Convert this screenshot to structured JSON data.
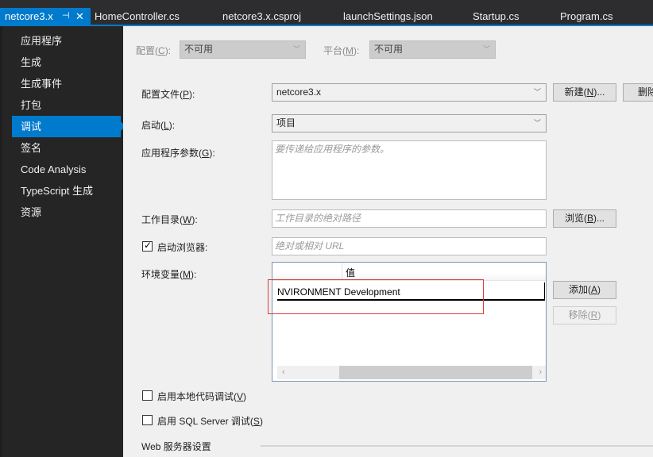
{
  "tabs": [
    {
      "label": "netcore3.x",
      "active": true,
      "pin_icon": "pin-icon",
      "close_icon": "close-icon"
    },
    {
      "label": "HomeController.cs"
    },
    {
      "label": "netcore3.x.csproj"
    },
    {
      "label": "launchSettings.json"
    },
    {
      "label": "Startup.cs"
    },
    {
      "label": "Program.cs"
    }
  ],
  "icons": {
    "pin": "⊣",
    "close": "✕",
    "chevron": "﹀",
    "check": "✓",
    "left": "‹",
    "right": "›"
  },
  "sidebar": {
    "items": [
      {
        "label": "应用程序"
      },
      {
        "label": "生成"
      },
      {
        "label": "生成事件"
      },
      {
        "label": "打包"
      },
      {
        "label": "调试",
        "active": true
      },
      {
        "label": "签名"
      },
      {
        "label": "Code Analysis"
      },
      {
        "label": "TypeScript 生成"
      },
      {
        "label": "资源"
      }
    ]
  },
  "config": {
    "label": "配置",
    "key": "C",
    "value": "不可用",
    "platform_label": "平台",
    "platform_key": "M",
    "platform_value": "不可用"
  },
  "profile": {
    "label": "配置文件",
    "key": "P",
    "value": "netcore3.x",
    "new_label": "新建",
    "new_key": "N",
    "new_suffix": "...",
    "delete_label": "删除"
  },
  "launch": {
    "label": "启动",
    "key": "L",
    "value": "项目"
  },
  "app_args": {
    "label": "应用程序参数",
    "key": "G",
    "placeholder": "要传递给应用程序的参数。"
  },
  "workdir": {
    "label": "工作目录",
    "key": "W",
    "placeholder": "工作目录的绝对路径",
    "browse_label": "浏览",
    "browse_key": "B",
    "browse_suffix": "..."
  },
  "browser": {
    "label": "启动浏览器:",
    "checked": true,
    "placeholder": "绝对或相对 URL"
  },
  "env": {
    "label": "环境变量",
    "key": "M",
    "columns": [
      "",
      "值"
    ],
    "rows": [
      {
        "name": "NVIRONMENT",
        "value": "Development"
      }
    ],
    "add_label": "添加",
    "add_key": "A",
    "remove_label": "移除",
    "remove_key": "R"
  },
  "native_debug": {
    "label": "启用本地代码调试",
    "key": "V",
    "checked": false
  },
  "sql_debug": {
    "label": "启用 SQL Server 调试",
    "key": "S",
    "checked": false
  },
  "web_server": {
    "label": "Web 服务器设置"
  },
  "colors": {
    "accent": "#007acc",
    "highlight_box": "#e03a3a"
  }
}
